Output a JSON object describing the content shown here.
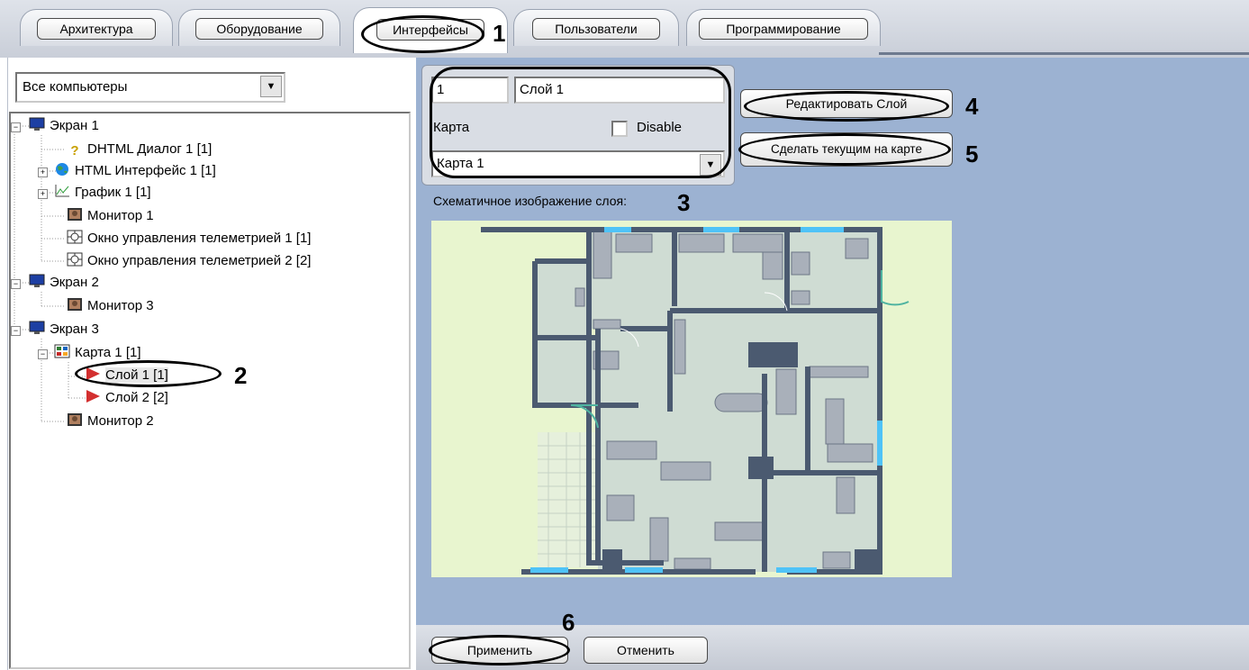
{
  "tabs": [
    {
      "label": "Архитектура"
    },
    {
      "label": "Оборудование"
    },
    {
      "label": "Интерфейсы"
    },
    {
      "label": "Пользователи"
    },
    {
      "label": "Программирование"
    }
  ],
  "active_tab": "Интерфейсы",
  "computer_select": {
    "value": "Все компьютеры"
  },
  "tree": [
    {
      "label": "Экран 1"
    },
    {
      "label": "DHTML Диалог 1 [1]"
    },
    {
      "label": "HTML Интерфейс 1 [1]"
    },
    {
      "label": "График 1 [1]"
    },
    {
      "label": "Монитор 1"
    },
    {
      "label": "Окно управления телеметрией 1 [1]"
    },
    {
      "label": "Окно управления телеметрией 2 [2]"
    },
    {
      "label": "Экран 2"
    },
    {
      "label": "Монитор 3"
    },
    {
      "label": "Экран 3"
    },
    {
      "label": "Карта 1 [1]"
    },
    {
      "label": "Слой 1 [1]"
    },
    {
      "label": "Слой 2 [2]"
    },
    {
      "label": "Монитор 2"
    }
  ],
  "layer": {
    "id": "1",
    "name": "Слой 1",
    "map_label": "Карта",
    "disable_label": "Disable",
    "map_value": "Карта 1"
  },
  "buttons": {
    "edit_layer": "Редактировать Слой",
    "make_current": "Сделать текущим на карте",
    "apply": "Применить",
    "cancel": "Отменить"
  },
  "schematic_label": "Схематичное изображение слоя:",
  "callouts": [
    "1",
    "2",
    "3",
    "4",
    "5",
    "6"
  ],
  "colors": {
    "panel_blue": "#9cb2d2",
    "map_bg": "#e8f5cf",
    "wall": "#4b5a70",
    "room": "#cfdcd3",
    "window": "#4fc3f7"
  }
}
